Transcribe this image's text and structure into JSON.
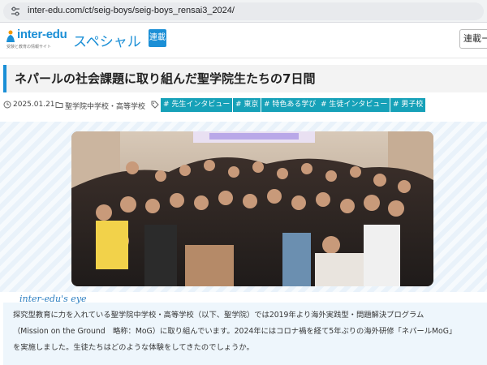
{
  "browser": {
    "url": "inter-edu.com/ct/seig-boys/seig-boys_rensai3_2024/"
  },
  "header": {
    "logo_text": "inter-edu",
    "logo_tagline": "受験と教育の情報サイト",
    "series_title": "スペシャル",
    "series_badge": "連載",
    "nav_button": "連載ー"
  },
  "article": {
    "title": "ネパールの社会課題に取り組んだ聖学院生たちの7日間",
    "date": "2025.01.21",
    "category": "聖学院中学校・高等学校",
    "tags": [
      "# 先生インタビュー",
      "# 東京",
      "# 特色ある学び",
      "# 生徒インタビュー",
      "# 男子校"
    ],
    "hero_alt": "group photo of students",
    "eye_label": "inter-edu's eye",
    "eye_lines": [
      "探究型教育に力を入れている聖学院中学校・高等学校（以下、聖学院）では2019年より海外実践型・問題解決プログラム",
      "（Mission on the Ground　略称：MoG）に取り組んでいます。2024年にはコロナ禍を経て5年ぶりの海外研修「ネパールMoG」",
      "を実施しました。生徒たちはどのような体験をしてきたのでしょうか。"
    ]
  },
  "colors": {
    "brand": "#1b8fd6",
    "tag": "#16a1b8",
    "eye_bg": "#eef6fc"
  }
}
